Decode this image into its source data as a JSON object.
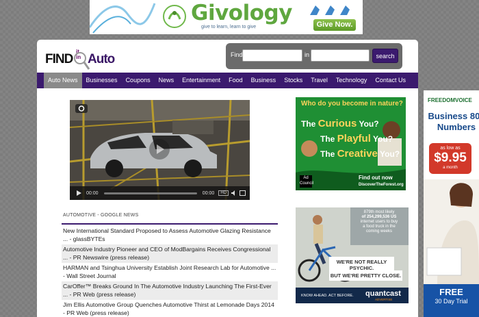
{
  "top_banner": {
    "brand": "Givology",
    "tagline": "give to learn, learn to give",
    "button_label": "Give Now."
  },
  "site": {
    "logo_find": "FIND",
    "logo_it": "it",
    "logo_in": "in",
    "logo_auto": "Auto"
  },
  "search": {
    "find_label": "Find",
    "in_label": "in",
    "find_value": "",
    "in_value": "",
    "button_label": "search"
  },
  "nav": {
    "items": [
      {
        "label": "Auto News",
        "active": true
      },
      {
        "label": "Businesses"
      },
      {
        "label": "Coupons"
      },
      {
        "label": "News"
      },
      {
        "label": "Entertainment"
      },
      {
        "label": "Food"
      },
      {
        "label": "Business"
      },
      {
        "label": "Stocks"
      },
      {
        "label": "Travel"
      },
      {
        "label": "Technology"
      },
      {
        "label": "Contact Us"
      }
    ]
  },
  "video": {
    "current_time": "00:00",
    "duration": "00:00",
    "hd_label": "HD"
  },
  "news": {
    "heading": "AUTOMOTIVE - GOOGLE NEWS",
    "items": [
      {
        "title": "New International Standard Proposed to Assess Automotive Glazing Resistance ... - glassBYTEs"
      },
      {
        "title": "Automotive Industry Pioneer and CEO of ModBargains Receives Congressional ... - PR Newswire (press release)"
      },
      {
        "title": "HARMAN and Tsinghua University Establish Joint Research Lab for Automotive ... - Wall Street Journal"
      },
      {
        "title": "CarOffer™ Breaks Ground In The Automotive Industry Launching The First-Ever ... - PR Web (press release)"
      },
      {
        "title": "Jim Ellis Automotive Group Quenches Automotive Thirst at Lemonade Days 2014 - PR Web (press release)"
      }
    ]
  },
  "ad_forest": {
    "question": "Who do you become in nature?",
    "line1_pre": "The",
    "line1_word": "Curious",
    "line1_post": "You?",
    "line2_pre": "The",
    "line2_word": "Playful",
    "line2_post": "You?",
    "line3_pre": "The",
    "line3_word": "Creative",
    "line3_post": "You?",
    "find_out": "Find out now",
    "site": "DiscoverTheForest.org",
    "ad_council": "Ad Council"
  },
  "ad_quantcast": {
    "stat_line1": "879th most likely",
    "stat_line2": "of 254,299,536 US",
    "stat_line3": "internet users to buy",
    "stat_line4": "a food truck in the",
    "stat_line5": "coming weeks",
    "psychic": "WE'RE NOT REALLY PSYCHIC.",
    "close": "BUT WE'RE PRETTY CLOSE.",
    "know_ahead": "KNOW AHEAD. ACT BEFORE.",
    "brand": "quantcast",
    "advertise": "ADVERTISE"
  },
  "ad_freedom": {
    "brand": "FREEDOMVOICE",
    "headline": "Business 800 Numbers",
    "as_low_as": "as low as",
    "price": "$9.95",
    "per": "a month",
    "free": "FREE",
    "trial": "30 Day Trial"
  },
  "colors": {
    "nav_bg": "#3b1a6e",
    "nav_active": "#8a8a8a",
    "page_bg": "#7d7d7d"
  }
}
